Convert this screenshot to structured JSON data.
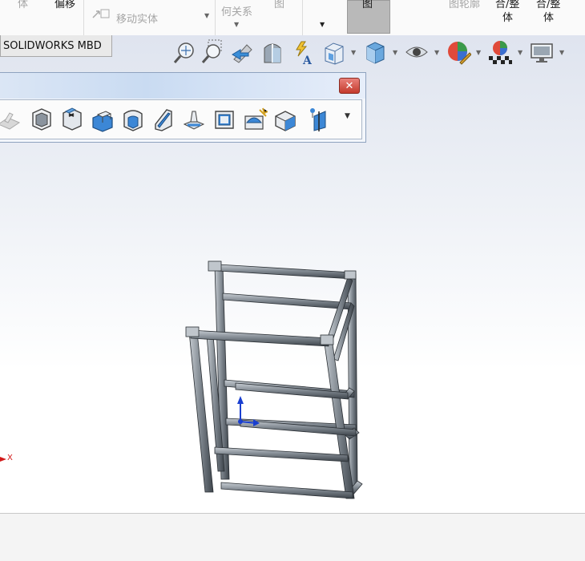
{
  "ribbon": {
    "frag_ti": "体",
    "offset_label": "偏移",
    "move_body_label": "移动实体",
    "geometry_frag": "何关系",
    "image_frag_1": "图",
    "image_frag_2": "图",
    "profile_frag": "图轮廓",
    "combine_line1": "合/整",
    "combine_line2": "体",
    "combine2_line1": "合/整",
    "combine2_line2": "体"
  },
  "tabs": {
    "mbd_label": "SOLIDWORKS MBD"
  },
  "hud_icons": [
    "zoom-to-fit-icon",
    "zoom-area-icon",
    "previous-view-icon",
    "section-view-icon",
    "dynamic-annotation-icon",
    "view-orientation-icon",
    "display-style-icon",
    "hide-show-icon",
    "edit-appearance-icon",
    "apply-scene-icon",
    "view-settings-icon"
  ],
  "feature_toolbar": {
    "close_glyph": "✕",
    "tools": [
      "rib-icon",
      "shell-icon",
      "extruded-cut-icon",
      "boss-extrude-icon",
      "fillet-icon",
      "chamfer-icon",
      "draft-icon",
      "wrap-icon",
      "dome-icon",
      "intersect-icon",
      "mirror-icon",
      "reference-plane-icon"
    ]
  },
  "axis": {
    "x_label": "X"
  },
  "colors": {
    "frame_steel": "#8e959c",
    "accent_blue": "#2060c0",
    "close_red": "#c43a2d"
  }
}
